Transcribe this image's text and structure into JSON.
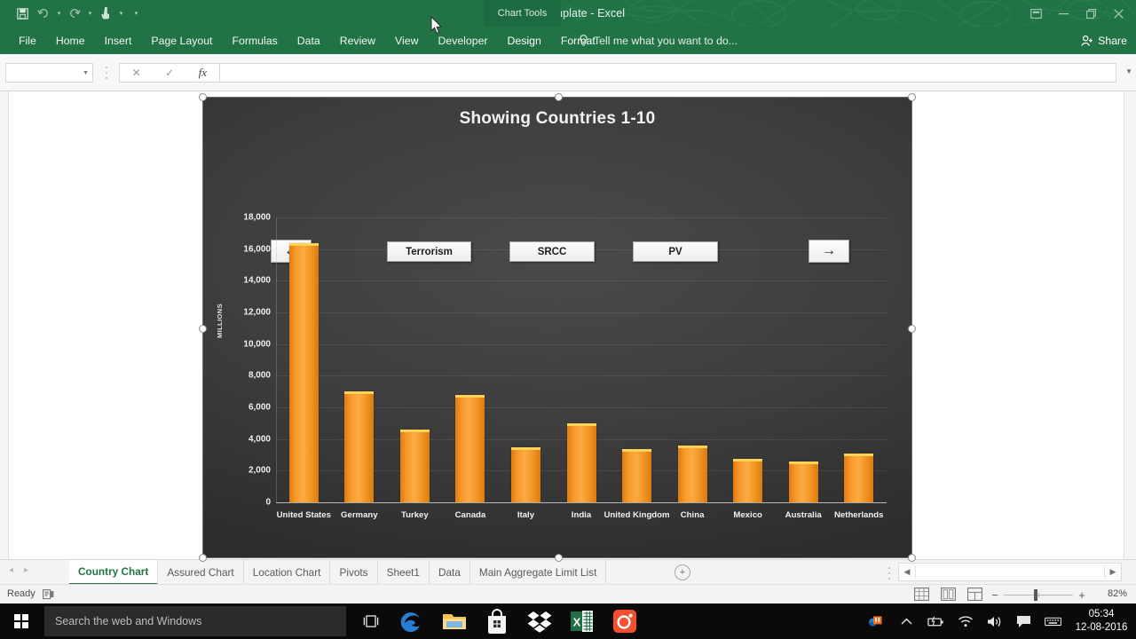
{
  "titlebar": {
    "document_title": "Chart Template - Excel",
    "contextual_tab_group": "Chart Tools",
    "qat": [
      {
        "name": "save-icon",
        "glyph": "ὋE"
      },
      {
        "name": "undo-icon",
        "glyph": "↶"
      },
      {
        "name": "redo-icon",
        "glyph": "↷"
      },
      {
        "name": "touch-mode-icon",
        "glyph": "☝"
      },
      {
        "name": "customize-qat-icon",
        "glyph": "▾"
      }
    ],
    "window_buttons": [
      {
        "name": "ribbon-display-options",
        "glyph": "⧉"
      },
      {
        "name": "minimize",
        "glyph": "─"
      },
      {
        "name": "restore",
        "glyph": "❐"
      },
      {
        "name": "close",
        "glyph": "✕"
      }
    ]
  },
  "ribbon": {
    "tabs": [
      {
        "label": "File",
        "contextual": false
      },
      {
        "label": "Home",
        "contextual": false
      },
      {
        "label": "Insert",
        "contextual": false
      },
      {
        "label": "Page Layout",
        "contextual": false
      },
      {
        "label": "Formulas",
        "contextual": false
      },
      {
        "label": "Data",
        "contextual": false
      },
      {
        "label": "Review",
        "contextual": false
      },
      {
        "label": "View",
        "contextual": false
      },
      {
        "label": "Developer",
        "contextual": false
      },
      {
        "label": "Design",
        "contextual": true
      },
      {
        "label": "Format",
        "contextual": true
      }
    ],
    "tell_me": "Tell me what you want to do...",
    "share": "Share"
  },
  "formula_bar": {
    "name_box_value": "",
    "formula_value": "",
    "cancel_label": "✕",
    "enter_label": "✓",
    "insert_function_label": "fx"
  },
  "chart_data": {
    "type": "bar",
    "title": "Showing Countries 1-10",
    "xlabel": "",
    "ylabel": "MILLIONS",
    "ylim": [
      0,
      18000
    ],
    "yticks": [
      0,
      2000,
      4000,
      6000,
      8000,
      10000,
      12000,
      14000,
      16000,
      18000
    ],
    "ytick_labels": [
      "0",
      "2,000",
      "4,000",
      "6,000",
      "8,000",
      "10,000",
      "12,000",
      "14,000",
      "16,000",
      "18,000"
    ],
    "grid": true,
    "legend": "none",
    "categories": [
      "United States",
      "Germany",
      "Turkey",
      "Canada",
      "Italy",
      "India",
      "United Kingdom",
      "China",
      "Mexico",
      "Australia",
      "Netherlands"
    ],
    "values": [
      16400,
      7000,
      4600,
      6800,
      3500,
      5000,
      3350,
      3600,
      2750,
      2600,
      3100
    ],
    "bar_color": "#F79A2A",
    "bar_highlight_color": "#FED257",
    "plot_background": "#3D3D3D"
  },
  "chart_controls": {
    "prev_button": "←",
    "next_button": "→",
    "filters": [
      "Terrorism",
      "SRCC",
      "PV"
    ]
  },
  "sheet_tabs": {
    "nav_prev": "◂",
    "nav_next": "▸",
    "add_label": "⊕",
    "items": [
      {
        "label": "Country Chart",
        "active": true
      },
      {
        "label": "Assured Chart",
        "active": false
      },
      {
        "label": "Location Chart",
        "active": false
      },
      {
        "label": "Pivots",
        "active": false
      },
      {
        "label": "Sheet1",
        "active": false
      },
      {
        "label": "Data",
        "active": false
      },
      {
        "label": "Main Aggregate Limit List",
        "active": false
      }
    ]
  },
  "status_bar": {
    "state": "Ready",
    "zoom_percent": "82%",
    "view_buttons": [
      "normal-view",
      "page-layout-view",
      "page-break-preview"
    ]
  },
  "taskbar": {
    "search_placeholder": "Search the web and Windows",
    "apps": [
      {
        "name": "edge-icon",
        "label": "e"
      },
      {
        "name": "file-explorer-icon",
        "label": ""
      },
      {
        "name": "store-icon",
        "label": ""
      },
      {
        "name": "dropbox-icon",
        "label": ""
      },
      {
        "name": "excel-icon",
        "label": "X"
      },
      {
        "name": "camera-app-icon",
        "label": ""
      }
    ],
    "tray": [
      {
        "name": "show-hidden-icons",
        "glyph": "∧"
      },
      {
        "name": "battery-icon",
        "glyph": ""
      },
      {
        "name": "wifi-icon",
        "glyph": ""
      },
      {
        "name": "volume-icon",
        "glyph": ""
      },
      {
        "name": "action-center-icon",
        "glyph": ""
      },
      {
        "name": "keyboard-icon",
        "glyph": ""
      }
    ],
    "clock_time": "05:34",
    "clock_date": "12-08-2016"
  }
}
